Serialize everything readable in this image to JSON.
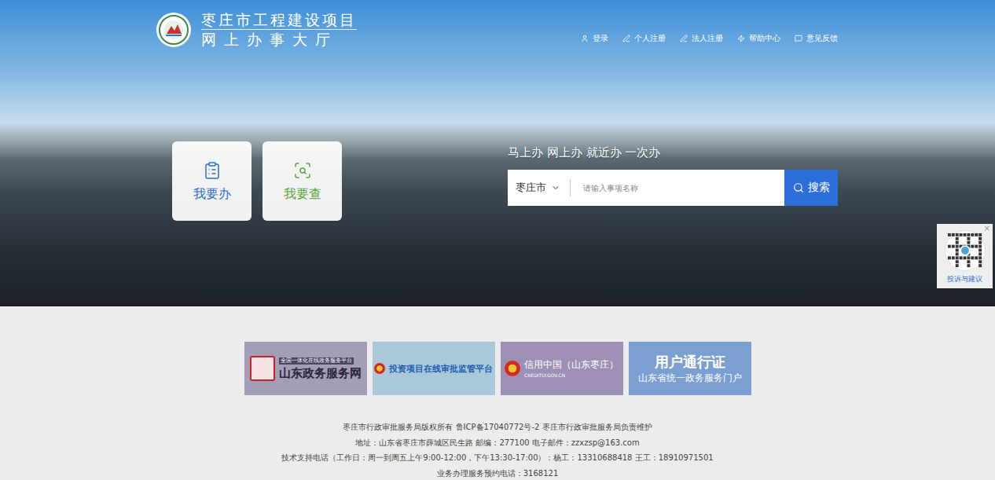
{
  "header": {
    "title": "枣庄市工程建设项目",
    "subtitle": "网 上 办 事 大 厅",
    "nav": [
      {
        "label": "登录"
      },
      {
        "label": "个人注册"
      },
      {
        "label": "法人注册"
      },
      {
        "label": "帮助中心"
      },
      {
        "label": "意见反馈"
      }
    ]
  },
  "cards": [
    {
      "label": "我要办",
      "kind": "do",
      "color": "#2e6fc8"
    },
    {
      "label": "我要查",
      "kind": "query",
      "color": "#5ba63b"
    }
  ],
  "search": {
    "slogan": "马上办 网上办 就近办 一次办",
    "region": "枣庄市",
    "placeholder": "请输入事项名称",
    "button": "搜索"
  },
  "float_widget": {
    "label": "投诉与建议",
    "close": "×"
  },
  "banners": [
    {
      "kind": "seal",
      "tag": "全国一体化在线政务服务平台",
      "title": "山东政务服务网",
      "subtitle": "",
      "color": "#a39db5"
    },
    {
      "kind": "emblem",
      "tag": "",
      "title": "投资项目在线审批监管平台",
      "subtitle": "",
      "color": "#aac8d9"
    },
    {
      "kind": "emblem-dark",
      "tag": "",
      "title": "信用中国（山东枣庄）",
      "subtitle": "CREDITLY.GOV.CN",
      "color": "#9e8fb7"
    },
    {
      "kind": "text",
      "tag": "",
      "title": "用户通行证",
      "subtitle": "山东省统一政务服务门户",
      "color": "#7c9fd1"
    }
  ],
  "footer": [
    "枣庄市行政审批服务局版权所有 鲁ICP备17040772号-2 枣庄市行政审批服务局负责维护",
    "地址：山东省枣庄市薛城区民生路 邮编：277100 电子邮件：zzxzsp@163.com",
    "技术支持电话（工作日：周一到周五上午9:00-12:00，下午13:30-17:00）：杨工：13310688418 王工：18910971501",
    "业务办理服务预约电话：3168121"
  ]
}
